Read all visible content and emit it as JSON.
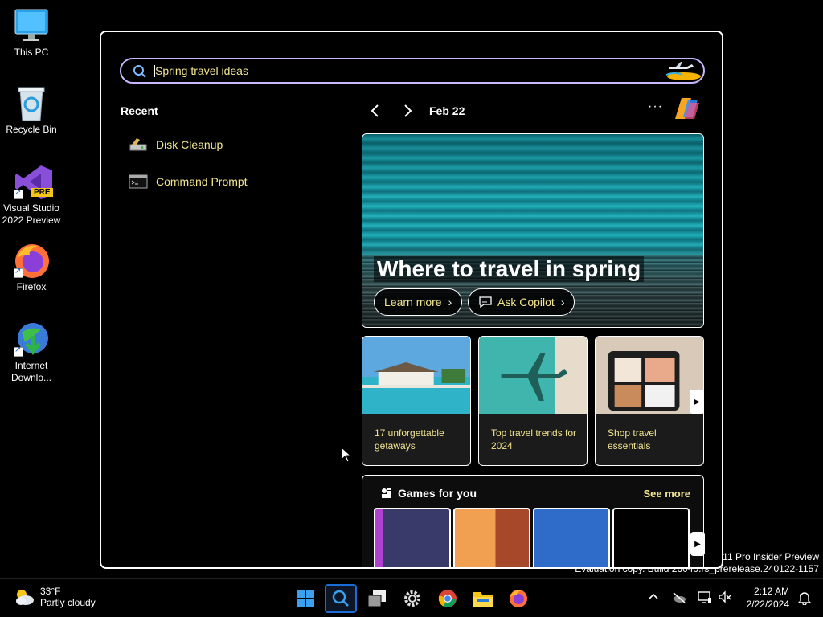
{
  "desktop": {
    "icons": [
      {
        "label": "This PC"
      },
      {
        "label": "Recycle Bin"
      },
      {
        "label": "Visual Studio 2022 Preview",
        "badge": "PRE"
      },
      {
        "label": "Firefox"
      },
      {
        "label": "Internet Downlo..."
      }
    ],
    "watermark_line1": "11 Pro Insider Preview",
    "watermark_line2": "Evaluation copy. Build 26040.rs_prerelease.240122-1157"
  },
  "search": {
    "value": "Spring travel ideas",
    "icon": "search-icon",
    "decor_icon": "airplane-illustration-icon"
  },
  "recent": {
    "heading": "Recent",
    "items": [
      {
        "label": "Disk Cleanup",
        "icon": "disk-cleanup-icon"
      },
      {
        "label": "Command Prompt",
        "icon": "command-prompt-icon"
      }
    ]
  },
  "widgets": {
    "prev_icon": "chevron-left-icon",
    "next_icon": "chevron-right-icon",
    "date": "Feb 22",
    "more": "···",
    "hero": {
      "title": "Where to travel in spring",
      "learn_more": "Learn more",
      "ask_copilot": "Ask Copilot"
    },
    "cards": [
      {
        "caption": "17 unforgettable getaways"
      },
      {
        "caption": "Top travel trends for 2024"
      },
      {
        "caption": "Shop travel essentials"
      }
    ],
    "games": {
      "heading": "Games for you",
      "see_more": "See more",
      "tile_colors": [
        "#3a3a6a",
        "#e07a3a",
        "#2f6cc9",
        "#000000"
      ]
    }
  },
  "taskbar": {
    "weather_temp": "33°F",
    "weather_desc": "Partly cloudy",
    "apps": [
      "start-icon",
      "search-icon",
      "task-view-icon",
      "settings-icon",
      "chrome-icon",
      "file-explorer-icon",
      "firefox-icon"
    ],
    "time": "2:12 AM",
    "date": "2/22/2024"
  },
  "colors": {
    "accent_text": "#f3e58f",
    "search_border": "#c9b6ff",
    "taskbar_active": "#1a6dd6"
  }
}
